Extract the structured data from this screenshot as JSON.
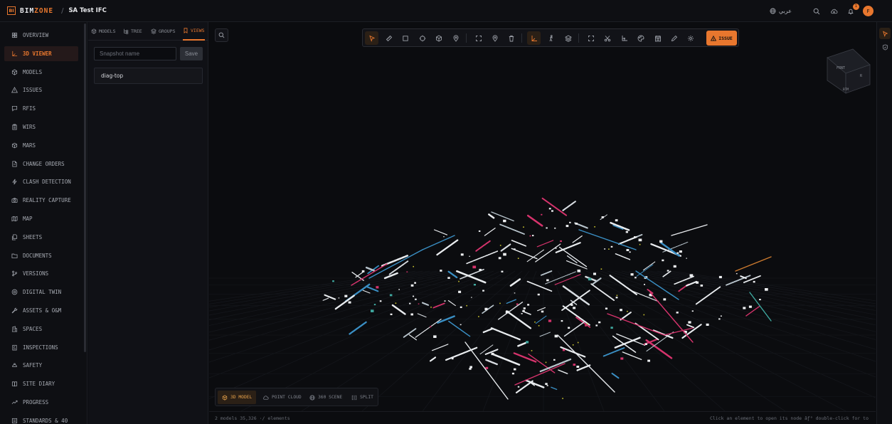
{
  "brand": {
    "mark": "BI",
    "name_a": "BIM",
    "name_b": "ZONE"
  },
  "breadcrumb": {
    "separator": "/",
    "project": "SA Test IFC"
  },
  "topbar": {
    "language": "عربي",
    "notifications": "1",
    "avatar": "F"
  },
  "sidebar": {
    "items": [
      {
        "label": "OVERVIEW",
        "icon": "grid-icon"
      },
      {
        "label": "3D VIEWER",
        "icon": "axes-icon",
        "active": true
      },
      {
        "label": "MODELS",
        "icon": "cubes-icon"
      },
      {
        "label": "ISSUES",
        "icon": "warning-icon"
      },
      {
        "label": "RFIS",
        "icon": "chat-icon"
      },
      {
        "label": "WIRS",
        "icon": "clipboard-icon"
      },
      {
        "label": "MARS",
        "icon": "package-icon"
      },
      {
        "label": "CHANGE ORDERS",
        "icon": "document-icon"
      },
      {
        "label": "CLASH DETECTION",
        "icon": "lightning-icon"
      },
      {
        "label": "REALITY CAPTURE",
        "icon": "camera-icon"
      },
      {
        "label": "MAP",
        "icon": "map-icon"
      },
      {
        "label": "SHEETS",
        "icon": "sheets-icon"
      },
      {
        "label": "DOCUMENTS",
        "icon": "folder-icon"
      },
      {
        "label": "VERSIONS",
        "icon": "branch-icon"
      },
      {
        "label": "DIGITAL TWIN",
        "icon": "target-icon"
      },
      {
        "label": "ASSETS & O&M",
        "icon": "wrench-icon"
      },
      {
        "label": "SPACES",
        "icon": "building-icon"
      },
      {
        "label": "INSPECTIONS",
        "icon": "checklist-icon"
      },
      {
        "label": "SAFETY",
        "icon": "helmet-icon"
      },
      {
        "label": "SITE DIARY",
        "icon": "book-icon"
      },
      {
        "label": "PROGRESS",
        "icon": "trend-icon"
      },
      {
        "label": "STANDARDS & 40",
        "icon": "standard-icon"
      }
    ]
  },
  "panel": {
    "tabs": [
      {
        "label": "MODELS",
        "icon": "cubes-icon"
      },
      {
        "label": "TREE",
        "icon": "tree-icon"
      },
      {
        "label": "GROUPS",
        "icon": "layers-icon"
      },
      {
        "label": "VIEWS",
        "icon": "bookmark-icon",
        "active": true
      }
    ],
    "snapshot_placeholder": "Snapshot name",
    "snapshot_value": "",
    "save_label": "Save",
    "views": [
      {
        "label": "diag-top"
      }
    ]
  },
  "toolbar": {
    "issue_label": "ISSUE",
    "tools": [
      "select",
      "measure",
      "section-box",
      "target",
      "cube",
      "pin",
      "fit",
      "location",
      "delete",
      "axes",
      "walk",
      "layers",
      "fullscreen",
      "cut",
      "plan",
      "palette",
      "calendar",
      "pencil",
      "settings"
    ]
  },
  "viewcube": {
    "front": "FRNT",
    "right": "R",
    "bottom": "BTM"
  },
  "modes": [
    {
      "label": "3D MODEL",
      "icon": "cube-icon",
      "active": true
    },
    {
      "label": "POINT CLOUD",
      "icon": "cloud-icon"
    },
    {
      "label": "360 SCENE",
      "icon": "globe-icon"
    },
    {
      "label": "SPLIT",
      "icon": "split-icon"
    }
  ],
  "status": {
    "left": "2 models 35,326 ·/ elements",
    "right": "Click an element to open its node âƒ° double-click for to"
  },
  "colors": {
    "accent": "#e8772e",
    "background": "#0b0c10",
    "panel": "#0e0f13"
  }
}
